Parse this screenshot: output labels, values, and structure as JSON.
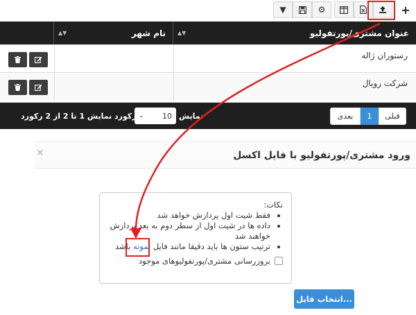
{
  "toolbar": {
    "buttons": [
      {
        "icon": "filter-icon",
        "glyph": "▼"
      },
      {
        "icon": "save-icon",
        "glyph": "🖫"
      },
      {
        "icon": "gear-icon",
        "glyph": "⚙"
      },
      {
        "icon": "columns-icon",
        "glyph": "◫"
      },
      {
        "icon": "excel-icon",
        "glyph": "X"
      },
      {
        "icon": "upload-icon",
        "glyph": "⇪"
      }
    ],
    "add_glyph": "+"
  },
  "table": {
    "columns": [
      "عنوان مشتری/پورتفولیو",
      "نام شهر"
    ],
    "rows": [
      {
        "name": "رستوران ژاله",
        "city": ""
      },
      {
        "name": "شرکت رویال",
        "city": ""
      }
    ]
  },
  "pager": {
    "info": "نمایش 1 تا 2 از 2 رکورد",
    "size_label": "رکورد",
    "page_size": "10",
    "show_label": "نمایش",
    "prev": "قبلی",
    "current": "1",
    "next": "بعدی"
  },
  "modal": {
    "title": "ورود مشتری/پورتفولیو با فایل اکسل",
    "close": "×",
    "notes_title": "نکات:",
    "note1": "فقط شیت اول پردازش خواهد شد",
    "note2": "داده ها در شیت اول از سطر دوم به بعد پردازش خواهند شد",
    "note3_before": "ترتیب ستون ها باید دقیقا مانند فایل ",
    "note3_link": "نمونه",
    "note3_after": " باشد",
    "checkbox_label": "بروزرسانی مشتری/پورتفولیوهای موجود",
    "file_button": "انتخاب فایل..."
  },
  "colors": {
    "accent": "#3a8fd8",
    "highlight": "#e02020",
    "header_dark": "#1f1f1f"
  }
}
